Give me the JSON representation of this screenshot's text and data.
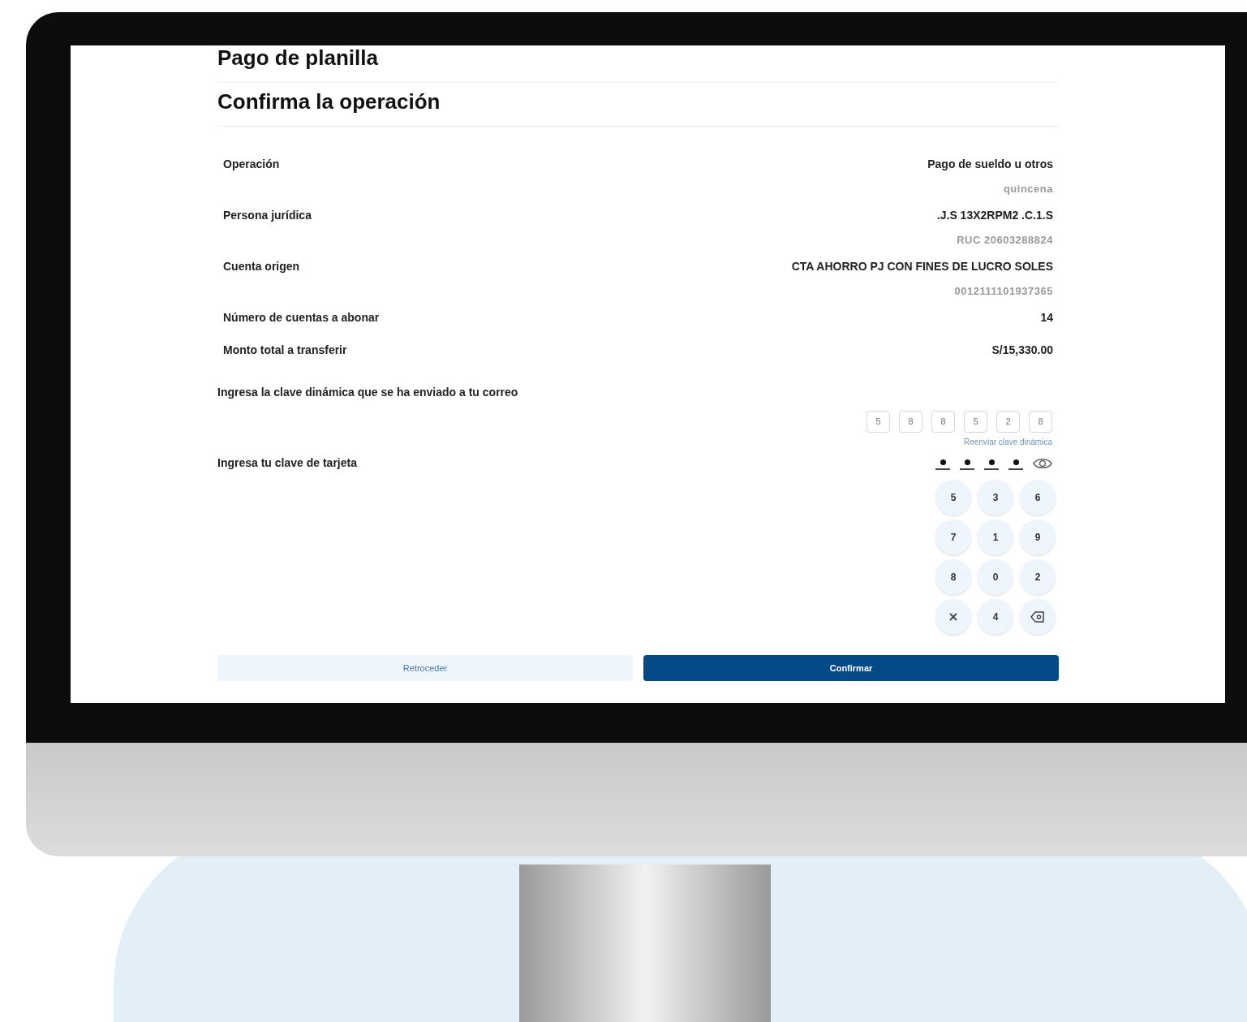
{
  "header": {
    "title": "Pago de planilla",
    "subtitle": "Confirma la operación"
  },
  "details": [
    {
      "label": "Operación",
      "value": "Pago de sueldo u otros",
      "secondary": "quincena"
    },
    {
      "label": "Persona jurídica",
      "value": ".J.S 13X2RPM2 .C.1.S",
      "secondary": "RUC 20603288824"
    },
    {
      "label": "Cuenta origen",
      "value": "CTA AHORRO PJ CON FINES DE LUCRO SOLES",
      "secondary": "0012111101937365"
    },
    {
      "label": "Número de cuentas a abonar",
      "value": "14"
    },
    {
      "label": "Monto total a transferir",
      "value": "S/15,330.00"
    }
  ],
  "dynamic_key": {
    "prompt": "Ingresa la clave dinámica que se ha enviado a tu correo",
    "digits": [
      "5",
      "8",
      "8",
      "5",
      "2",
      "8"
    ],
    "resend_link": "Reenviar clave dinámica"
  },
  "card_key": {
    "prompt": "Ingresa tu clave de tarjeta",
    "slots": [
      {
        "filled": true
      },
      {
        "filled": true
      },
      {
        "filled": true
      },
      {
        "filled": true
      }
    ]
  },
  "keypad": [
    {
      "kind": "digit",
      "label": "5"
    },
    {
      "kind": "digit",
      "label": "3"
    },
    {
      "kind": "digit",
      "label": "6"
    },
    {
      "kind": "digit",
      "label": "7"
    },
    {
      "kind": "digit",
      "label": "1"
    },
    {
      "kind": "digit",
      "label": "9"
    },
    {
      "kind": "digit",
      "label": "8"
    },
    {
      "kind": "digit",
      "label": "0"
    },
    {
      "kind": "digit",
      "label": "2"
    },
    {
      "kind": "clear"
    },
    {
      "kind": "digit",
      "label": "4"
    },
    {
      "kind": "backspace"
    }
  ],
  "buttons": {
    "back": "Retroceder",
    "confirm": "Confirmar"
  }
}
